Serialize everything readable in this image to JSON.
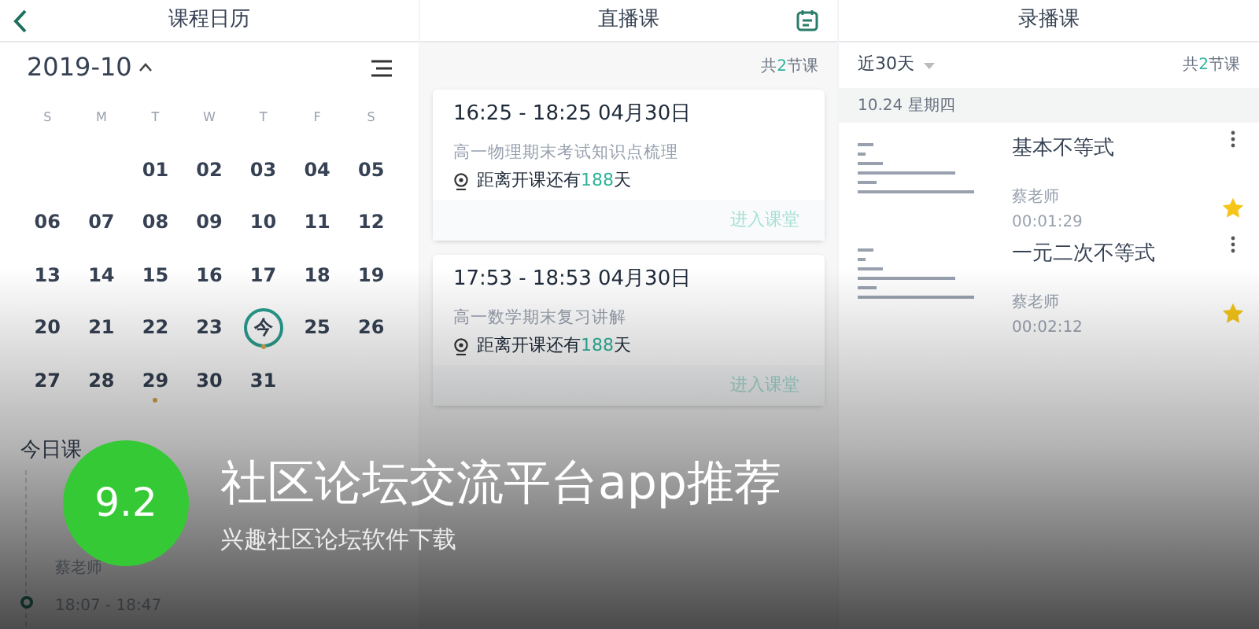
{
  "calendar_screen": {
    "title": "课程日历",
    "month": "2019-10",
    "weekdays": [
      "S",
      "M",
      "T",
      "W",
      "T",
      "F",
      "S"
    ],
    "weeks": [
      [
        {
          "label": "01",
          "today": false,
          "has_course": false
        },
        {
          "label": "02",
          "today": false,
          "has_course": false
        },
        {
          "label": "03",
          "today": false,
          "has_course": false
        },
        {
          "label": "04",
          "today": false,
          "has_course": false
        },
        {
          "label": "05",
          "today": false,
          "has_course": false
        }
      ],
      [
        {
          "label": "06",
          "today": false,
          "has_course": false
        },
        {
          "label": "07",
          "today": false,
          "has_course": false
        },
        {
          "label": "08",
          "today": false,
          "has_course": false
        },
        {
          "label": "09",
          "today": false,
          "has_course": false
        },
        {
          "label": "10",
          "today": false,
          "has_course": false
        },
        {
          "label": "11",
          "today": false,
          "has_course": false
        },
        {
          "label": "12",
          "today": false,
          "has_course": false
        }
      ],
      [
        {
          "label": "13",
          "today": false,
          "has_course": false
        },
        {
          "label": "14",
          "today": false,
          "has_course": false
        },
        {
          "label": "15",
          "today": false,
          "has_course": false
        },
        {
          "label": "16",
          "today": false,
          "has_course": false
        },
        {
          "label": "17",
          "today": false,
          "has_course": false
        },
        {
          "label": "18",
          "today": false,
          "has_course": false
        },
        {
          "label": "19",
          "today": false,
          "has_course": false
        }
      ],
      [
        {
          "label": "20",
          "today": false,
          "has_course": false
        },
        {
          "label": "21",
          "today": false,
          "has_course": false
        },
        {
          "label": "22",
          "today": false,
          "has_course": false
        },
        {
          "label": "23",
          "today": false,
          "has_course": false
        },
        {
          "label": "今",
          "today": true,
          "has_course": true
        },
        {
          "label": "25",
          "today": false,
          "has_course": false
        },
        {
          "label": "26",
          "today": false,
          "has_course": false
        }
      ],
      [
        {
          "label": "27",
          "today": false,
          "has_course": false
        },
        {
          "label": "28",
          "today": false,
          "has_course": false
        },
        {
          "label": "29",
          "today": false,
          "has_course": true
        },
        {
          "label": "30",
          "today": false,
          "has_course": false
        },
        {
          "label": "31",
          "today": false,
          "has_course": false
        }
      ]
    ],
    "today_section": {
      "title": "今日课",
      "items": [
        {
          "kind": "teacher",
          "text": "蔡老师"
        },
        {
          "kind": "time",
          "text": "18:07 - 18:47"
        }
      ]
    }
  },
  "live_screen": {
    "title": "直播课",
    "count": {
      "prefix": "共",
      "number": "2",
      "suffix": "节课"
    },
    "cards": [
      {
        "time": "16:25 - 18:25  04月30日",
        "name": "高一物理期末考试知识点梳理",
        "countdown": {
          "prefix": "距离开课还有",
          "number": "188",
          "suffix": "天"
        },
        "action": "进入课堂"
      },
      {
        "time": "17:53 - 18:53  04月30日",
        "name": "高一数学期末复习讲解",
        "countdown": {
          "prefix": "距离开课还有",
          "number": "188",
          "suffix": "天"
        },
        "action": "进入课堂"
      }
    ]
  },
  "recorded_screen": {
    "title": "录播课",
    "filter": "近30天",
    "count": {
      "prefix": "共",
      "number": "2",
      "suffix": "节课"
    },
    "date": "10.24 星期四",
    "items": [
      {
        "title": "基本不等式",
        "teacher": "蔡老师",
        "duration": "00:01:29",
        "starred": true
      },
      {
        "title": "一元二次不等式",
        "teacher": "蔡老师",
        "duration": "00:02:12",
        "starred": true
      }
    ]
  },
  "banner": {
    "score": "9.2",
    "title": "社区论坛交流平台app推荐",
    "subtitle": "兴趣社区论坛软件下载"
  }
}
